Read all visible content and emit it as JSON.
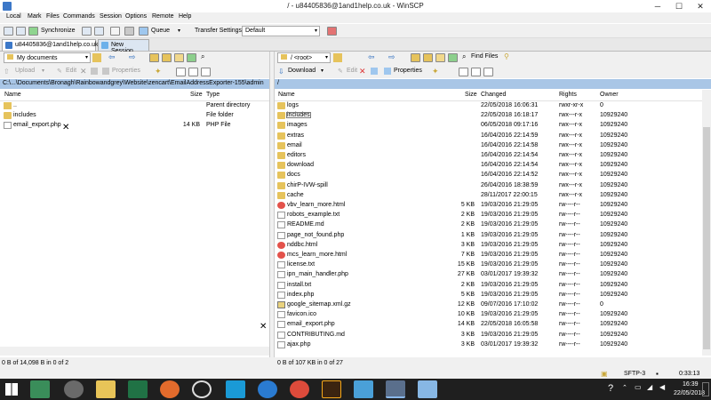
{
  "window": {
    "title": "/ - u84405836@1and1help.co.uk - WinSCP",
    "minimize": "─",
    "maximize": "☐",
    "close": "✕"
  },
  "menu": [
    "Local",
    "Mark",
    "Files",
    "Commands",
    "Session",
    "Options",
    "Remote",
    "Help"
  ],
  "toolbar": {
    "synchronize": "Synchronize",
    "queue": "Queue",
    "transfer_settings_label": "Transfer Settings",
    "transfer_settings_value": "Default"
  },
  "tabs": [
    {
      "label": "u84405836@1and1help.co.uk"
    },
    {
      "label": "New Session"
    }
  ],
  "left": {
    "location": "My documents",
    "actions": [
      "Upload",
      "Edit",
      "Properties"
    ],
    "path": "C:\\...\\Documents\\Bronagh\\Rainbowandgrey\\Website\\zencart\\EmailAddressExporter-155\\admin",
    "columns": [
      "Name",
      "Size",
      "Type"
    ],
    "files": [
      {
        "name": "..",
        "size": "",
        "type": "Parent directory",
        "icon": "up-folder-icon"
      },
      {
        "name": "includes",
        "size": "",
        "type": "File folder",
        "icon": "folder-icon"
      },
      {
        "name": "email_export.php",
        "size": "14 KB",
        "type": "PHP File",
        "icon": "file-icon"
      }
    ],
    "status": "0 B of 14,098 B in 0 of 2"
  },
  "right": {
    "location": "/ <root>",
    "actions": [
      "Download",
      "Edit",
      "Properties"
    ],
    "find_files": "Find Files",
    "path": "/",
    "columns": [
      "Name",
      "Size",
      "Changed",
      "Rights",
      "Owner"
    ],
    "files": [
      {
        "name": "logs",
        "size": "",
        "changed": "22/05/2018 16:06:31",
        "rights": "rwxr-xr-x",
        "owner": "0",
        "icon": "folder-icon"
      },
      {
        "name": "includes",
        "size": "",
        "changed": "22/05/2018 16:18:17",
        "rights": "rwx---r-x",
        "owner": "10929240",
        "icon": "folder-icon"
      },
      {
        "name": "images",
        "size": "",
        "changed": "06/05/2018 09:17:16",
        "rights": "rwx---r-x",
        "owner": "10929240",
        "icon": "folder-icon"
      },
      {
        "name": "extras",
        "size": "",
        "changed": "16/04/2016 22:14:59",
        "rights": "rwx---r-x",
        "owner": "10929240",
        "icon": "folder-icon"
      },
      {
        "name": "email",
        "size": "",
        "changed": "16/04/2016 22:14:58",
        "rights": "rwx---r-x",
        "owner": "10929240",
        "icon": "folder-icon"
      },
      {
        "name": "editors",
        "size": "",
        "changed": "16/04/2016 22:14:54",
        "rights": "rwx---r-x",
        "owner": "10929240",
        "icon": "folder-icon"
      },
      {
        "name": "download",
        "size": "",
        "changed": "16/04/2016 22:14:54",
        "rights": "rwx---r-x",
        "owner": "10929240",
        "icon": "folder-icon"
      },
      {
        "name": "docs",
        "size": "",
        "changed": "16/04/2016 22:14:52",
        "rights": "rwx---r-x",
        "owner": "10929240",
        "icon": "folder-icon"
      },
      {
        "name": "chirP-IVW-spill",
        "size": "",
        "changed": "26/04/2016 18:38:59",
        "rights": "rwx---r-x",
        "owner": "10929240",
        "icon": "folder-icon"
      },
      {
        "name": "cache",
        "size": "",
        "changed": "28/11/2017 22:00:15",
        "rights": "rwx---r-x",
        "owner": "10929240",
        "icon": "folder-icon"
      },
      {
        "name": "vbv_learn_more.html",
        "size": "5 KB",
        "changed": "19/03/2016 21:29:05",
        "rights": "rw----r--",
        "owner": "10929240",
        "icon": "chrome-icon"
      },
      {
        "name": "robots_example.txt",
        "size": "2 KB",
        "changed": "19/03/2016 21:29:05",
        "rights": "rw----r--",
        "owner": "10929240",
        "icon": "file-icon"
      },
      {
        "name": "README.md",
        "size": "2 KB",
        "changed": "19/03/2016 21:29:05",
        "rights": "rw----r--",
        "owner": "10929240",
        "icon": "file-icon"
      },
      {
        "name": "page_not_found.php",
        "size": "1 KB",
        "changed": "19/03/2016 21:29:05",
        "rights": "rw----r--",
        "owner": "10929240",
        "icon": "file-icon"
      },
      {
        "name": "nddbc.html",
        "size": "3 KB",
        "changed": "19/03/2016 21:29:05",
        "rights": "rw----r--",
        "owner": "10929240",
        "icon": "chrome-icon"
      },
      {
        "name": "mcs_learn_more.html",
        "size": "7 KB",
        "changed": "19/03/2016 21:29:05",
        "rights": "rw----r--",
        "owner": "10929240",
        "icon": "chrome-icon"
      },
      {
        "name": "license.txt",
        "size": "15 KB",
        "changed": "19/03/2016 21:29:05",
        "rights": "rw----r--",
        "owner": "10929240",
        "icon": "file-icon"
      },
      {
        "name": "ipn_main_handler.php",
        "size": "27 KB",
        "changed": "03/01/2017 19:39:32",
        "rights": "rw----r--",
        "owner": "10929240",
        "icon": "file-icon"
      },
      {
        "name": "install.txt",
        "size": "2 KB",
        "changed": "19/03/2016 21:29:05",
        "rights": "rw----r--",
        "owner": "10929240",
        "icon": "file-icon"
      },
      {
        "name": "index.php",
        "size": "5 KB",
        "changed": "19/03/2016 21:29:05",
        "rights": "rw----r--",
        "owner": "10929240",
        "icon": "file-icon"
      },
      {
        "name": "google_sitemap.xml.gz",
        "size": "12 KB",
        "changed": "09/07/2016 17:10:02",
        "rights": "rw----r--",
        "owner": "0",
        "icon": "archive-icon"
      },
      {
        "name": "favicon.ico",
        "size": "10 KB",
        "changed": "19/03/2016 21:29:05",
        "rights": "rw----r--",
        "owner": "10929240",
        "icon": "file-icon"
      },
      {
        "name": "email_export.php",
        "size": "14 KB",
        "changed": "22/05/2018 16:05:58",
        "rights": "rw----r--",
        "owner": "10929240",
        "icon": "file-icon"
      },
      {
        "name": "CONTRIBUTING.md",
        "size": "3 KB",
        "changed": "19/03/2016 21:29:05",
        "rights": "rw----r--",
        "owner": "10929240",
        "icon": "file-icon"
      },
      {
        "name": "ajax.php",
        "size": "3 KB",
        "changed": "03/01/2017 19:39:32",
        "rights": "rw----r--",
        "owner": "10929240",
        "icon": "file-icon"
      }
    ],
    "status": "0 B of 107 KB in 0 of 27"
  },
  "status": {
    "protocol": "SFTP-3",
    "elapsed": "0:33:13"
  },
  "taskbar": {
    "time": "16:39",
    "date": "22/05/2018",
    "help": "?"
  },
  "colors": {
    "path_bar": "#a9c6e6",
    "folder": "#e6c35c",
    "taskbar": "#1f1f1f"
  }
}
